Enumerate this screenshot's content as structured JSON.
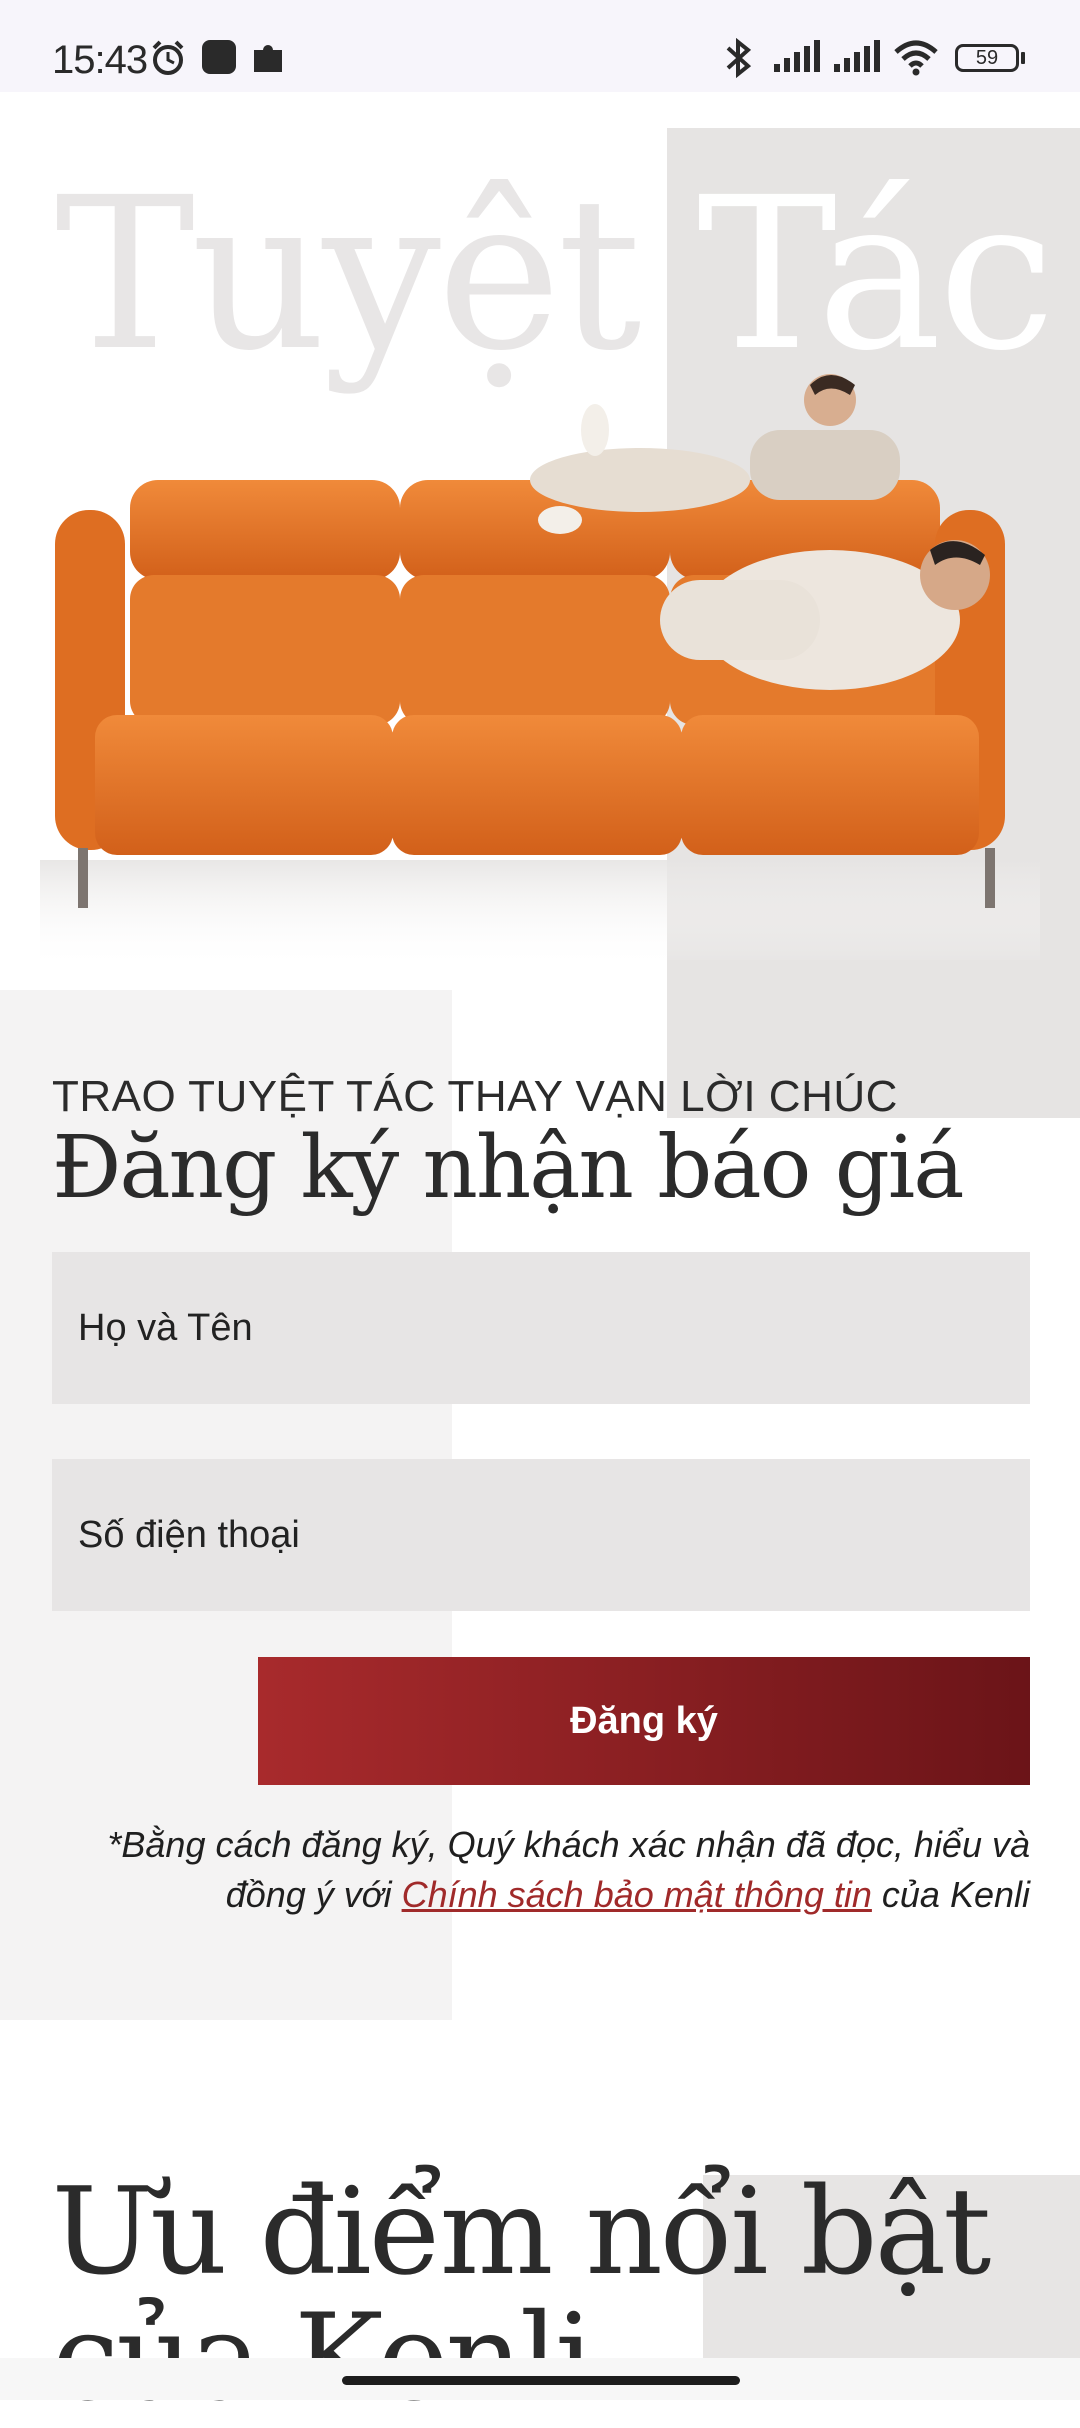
{
  "status_bar": {
    "time": "15:43",
    "battery": "59",
    "icons": [
      "alarm-icon",
      "square-icon",
      "puzzle-icon",
      "bluetooth-icon",
      "signal-icon",
      "signal-icon",
      "wifi-icon",
      "battery-icon"
    ]
  },
  "hero": {
    "title_left": "Tuyệt",
    "title_right": "Tác",
    "image": "orange-sofa-family-image"
  },
  "form": {
    "subtitle": "TRAO TUYỆT TÁC THAY VẠN LỜI CHÚC",
    "title": "Đăng ký nhận báo giá",
    "name_placeholder": "Họ và Tên",
    "phone_placeholder": "Số điện thoại",
    "submit_label": "Đăng ký",
    "note_prefix": "*Bằng cách đăng ký, Quý khách xác nhận đã đọc, hiểu và đồng ý với ",
    "policy_link": "Chính sách bảo mật thông tin",
    "note_suffix": " của Kenli"
  },
  "advantages": {
    "title": "Ưu điểm nổi bật của Kenli"
  },
  "colors": {
    "accent_red": "#a82a2c",
    "accent_red_dark": "#6b1418",
    "sofa_orange": "#e07326"
  }
}
